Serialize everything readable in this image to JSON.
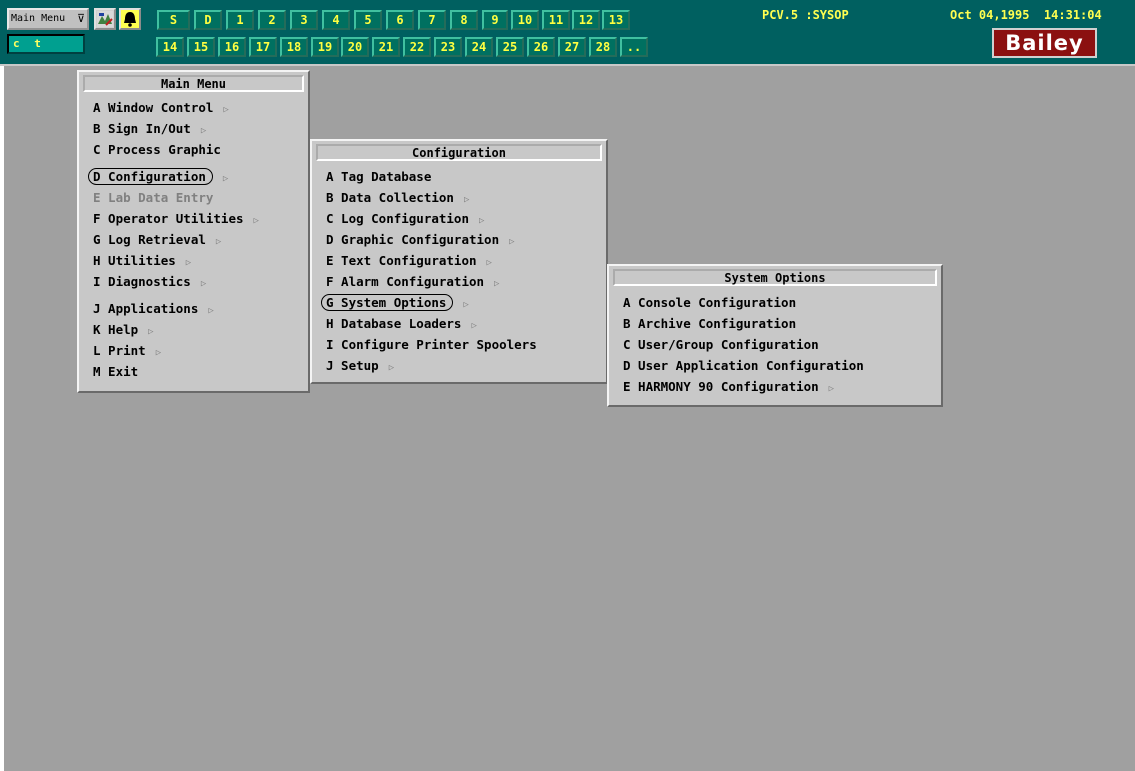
{
  "toolbar": {
    "menu_button_label": "Main Menu",
    "menu_button_chevron": "⊽",
    "mode_text": "c t",
    "row1_buttons": [
      "S",
      "D",
      "1",
      "2",
      "3",
      "4",
      "5",
      "6",
      "7",
      "8",
      "9",
      "10",
      "11",
      "12",
      "13"
    ],
    "row2_buttons": [
      "14",
      "15",
      "16",
      "17",
      "18",
      "19",
      "20",
      "21",
      "22",
      "23",
      "24",
      "25",
      "26",
      "27",
      "28",
      ".."
    ],
    "station": "PCV.5 :SYSOP",
    "datetime": "Oct 04,1995  14:31:04",
    "logo": "Bailey",
    "icons": [
      "graphic-icon",
      "bell-icon"
    ]
  },
  "main_menu": {
    "title": "Main Menu",
    "items": [
      {
        "label": "A Window Control",
        "arrow": "▷"
      },
      {
        "label": "B Sign In/Out",
        "arrow": "▷"
      },
      {
        "label": "C Process Graphic",
        "arrow": ""
      },
      {
        "label": "D Configuration",
        "arrow": "▷"
      },
      {
        "label": "E Lab Data Entry",
        "arrow": ""
      },
      {
        "label": "F Operator Utilities",
        "arrow": "▷"
      },
      {
        "label": "G Log Retrieval",
        "arrow": "▷"
      },
      {
        "label": "H Utilities",
        "arrow": "▷"
      },
      {
        "label": "I Diagnostics",
        "arrow": "▷"
      },
      {
        "label": "J Applications",
        "arrow": "▷"
      },
      {
        "label": "K Help",
        "arrow": "▷"
      },
      {
        "label": "L Print",
        "arrow": "▷"
      },
      {
        "label": "M Exit",
        "arrow": ""
      }
    ]
  },
  "configuration_menu": {
    "title": "Configuration",
    "items": [
      {
        "label": "A Tag Database",
        "arrow": ""
      },
      {
        "label": "B Data Collection",
        "arrow": "▷"
      },
      {
        "label": "C Log Configuration",
        "arrow": "▷"
      },
      {
        "label": "D Graphic Configuration",
        "arrow": "▷"
      },
      {
        "label": "E Text Configuration",
        "arrow": "▷"
      },
      {
        "label": "F Alarm Configuration",
        "arrow": "▷"
      },
      {
        "label": "G System Options",
        "arrow": "▷"
      },
      {
        "label": "H Database Loaders",
        "arrow": "▷"
      },
      {
        "label": "I Configure Printer Spoolers",
        "arrow": ""
      },
      {
        "label": "J Setup",
        "arrow": "▷"
      }
    ]
  },
  "system_options_menu": {
    "title": "System Options",
    "items": [
      {
        "label": "A Console Configuration",
        "arrow": ""
      },
      {
        "label": "B Archive Configuration",
        "arrow": ""
      },
      {
        "label": "C User/Group Configuration",
        "arrow": ""
      },
      {
        "label": "D User Application Configuration",
        "arrow": ""
      },
      {
        "label": "E HARMONY 90 Configuration",
        "arrow": "▷"
      }
    ]
  }
}
